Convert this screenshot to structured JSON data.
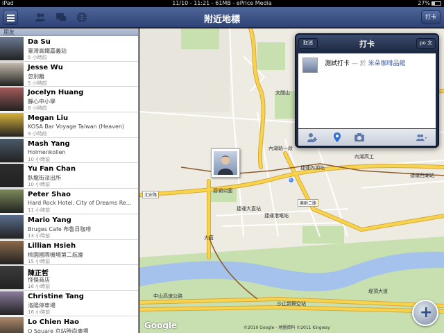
{
  "status_bar": {
    "device": "iPad",
    "center": "11/10 - 11:21 - 61MB - ePrice Media",
    "battery": "27%"
  },
  "nav": {
    "title": "附近地標",
    "checkin_label": "打卡"
  },
  "sidebar": {
    "header": "朋友",
    "friends": [
      {
        "name": "Da Su",
        "place": "臺灣高鐵嘉義站",
        "time": "5 小時前"
      },
      {
        "name": "Jesse Wu",
        "place": "忽別離",
        "time": "5 小時前"
      },
      {
        "name": "Jocelyn Huang",
        "place": "靜心中小學",
        "time": "8 小時前"
      },
      {
        "name": "Megan Liu",
        "place": "KOSA Bar Voyage Taiwan (Heaven)",
        "time": "9 小時前"
      },
      {
        "name": "Mash Yang",
        "place": "Holmenkollen",
        "time": "10 小時前"
      },
      {
        "name": "Yu Fan Chan",
        "place": "臥龍街派出所",
        "time": "10 小時前"
      },
      {
        "name": "Peter Shao",
        "place": "Hard Rock Hotel, City of Dreams Re...",
        "time": "11 小時前"
      },
      {
        "name": "Mario Yang",
        "place": "Bruges Cafe 布魯日咖啡",
        "time": "13 小時前"
      },
      {
        "name": "Lillian Hsieh",
        "place": "桃園國際機場第二航廈",
        "time": "15 小時前"
      },
      {
        "name": "陳正哲",
        "place": "怪傑商店",
        "time": "16 小時前"
      },
      {
        "name": "Christine Tang",
        "place": "洛陽停車場",
        "time": "16 小時前"
      },
      {
        "name": "Lo Chien Hao",
        "place": "Q Square 京站時尚廣場",
        "time": ""
      }
    ]
  },
  "map": {
    "google": "Google",
    "copyright": "©2010 Google - 地圖資料 ©2011 Kingway",
    "labels": [
      {
        "text": "文間山",
        "cls": "maplabel"
      },
      {
        "text": "捷運內湖站",
        "cls": "maplabel"
      },
      {
        "text": "捷運西湖站",
        "cls": "maplabel"
      },
      {
        "text": "內湖高工",
        "cls": "maplabel"
      },
      {
        "text": "捷運港墘站",
        "cls": "maplabel"
      },
      {
        "text": "碧湖公園",
        "cls": "maplabel"
      },
      {
        "text": "捷運大直站",
        "cls": "maplabel"
      },
      {
        "text": "大直",
        "cls": "maplabel"
      },
      {
        "text": "中山高速公路",
        "cls": "maplabel"
      },
      {
        "text": "沙止新鮮空站",
        "cls": "maplabel"
      },
      {
        "text": "北安路",
        "cls": "roadlabel"
      },
      {
        "text": "樂群二路",
        "cls": "roadlabel"
      },
      {
        "text": "堤頂大道",
        "cls": "maplabel"
      },
      {
        "text": "內湖路一段",
        "cls": "maplabel"
      }
    ]
  },
  "popover": {
    "cancel": "取消",
    "title": "打卡",
    "post": "po 文",
    "message": "測試打卡",
    "separator": " — 於 ",
    "location": "米朵咖啡品館"
  },
  "colors": {
    "nav": "#3b5998",
    "road_major": "#f7d44d",
    "road_edge": "#d9a838",
    "river": "#a4c2ec",
    "park": "#c8dfb0",
    "map_bg": "#eeebe2"
  }
}
